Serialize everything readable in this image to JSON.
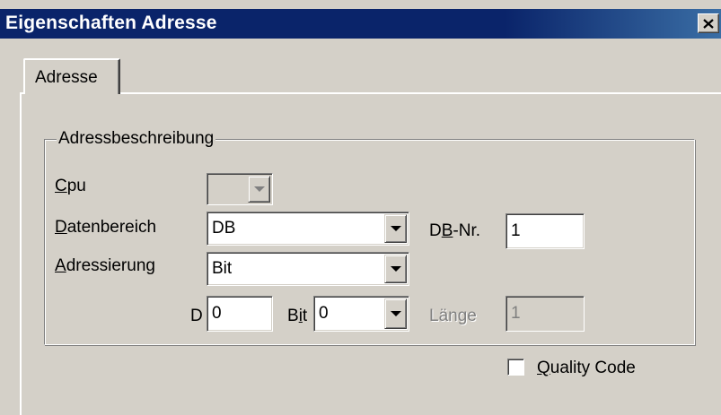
{
  "window": {
    "title": "Eigenschaften Adresse",
    "close_icon": "close-icon"
  },
  "tabs": [
    {
      "label": "Adresse",
      "selected": true
    }
  ],
  "group": {
    "title": "Adressbeschreibung"
  },
  "fields": {
    "cpu": {
      "label_mnemonic": "C",
      "label_rest": "pu",
      "value": "",
      "enabled": false
    },
    "datenbereich": {
      "label_mnemonic": "D",
      "label_rest": "atenbereich",
      "value": "DB"
    },
    "db_nr": {
      "label_pre": "D",
      "label_mnemonic": "B",
      "label_post": "-Nr.",
      "value": "1"
    },
    "adressierung": {
      "label_mnemonic": "A",
      "label_rest": "dressierung",
      "value": "Bit"
    },
    "d": {
      "label": "D",
      "value": "0"
    },
    "bit": {
      "label_pre": "B",
      "label_mnemonic": "i",
      "label_post": "t",
      "value": "0"
    },
    "laenge": {
      "label": "Länge",
      "value": "1",
      "enabled": false
    }
  },
  "quality_code": {
    "label_mnemonic": "Q",
    "label_rest": "uality Code",
    "checked": false
  },
  "colors": {
    "titlebar": "#0a246a",
    "face": "#d4d0c8",
    "disabled_text": "#808080"
  }
}
